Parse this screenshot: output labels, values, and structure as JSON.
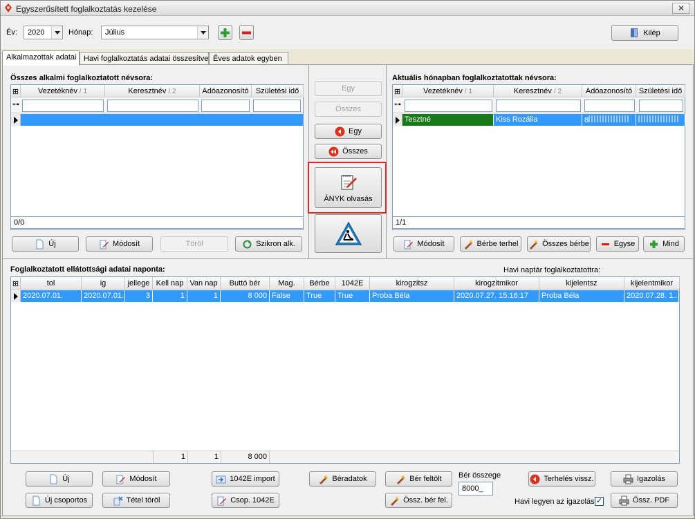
{
  "window": {
    "title": "Egyszerűsített foglalkoztatás kezelése",
    "close_glyph": "✕"
  },
  "top": {
    "year_label": "Év:",
    "year_value": "2020",
    "month_label": "Hónap:",
    "month_value": "Július",
    "exit_label": "Kilép"
  },
  "tabs": [
    {
      "label": "Alkalmazottak adatai"
    },
    {
      "label": "Havi foglalkoztatás adatai összesítve"
    },
    {
      "label": "Éves adatok egyben"
    }
  ],
  "left_grid": {
    "title": "Összes alkalmi foglalkoztatott névsora:",
    "columns": [
      "Vezetéknév",
      "Keresztnév",
      "Adóazonosító",
      "Születési idő"
    ],
    "sort_marks": [
      "/ 1",
      "/ 2"
    ],
    "status": "0/0",
    "buttons": {
      "new": "Új",
      "edit": "Módosít",
      "delete": "Töröl",
      "sync": "Szikron alk."
    }
  },
  "middle": {
    "one_right": "Egy",
    "all_right": "Összes",
    "one_left": "Egy",
    "all_left": "Összes",
    "anyk": "ÁNYK olvasás"
  },
  "right_grid": {
    "title": "Aktuális hónapban foglalkoztatottak névsora:",
    "columns": [
      "Vezetéknév",
      "Keresztnév",
      "Adóazonosító",
      "Születési idő"
    ],
    "sort_marks": [
      "/ 1",
      "/ 2"
    ],
    "rows": [
      {
        "last": "Tesztné",
        "first": "Kiss Rozália",
        "tax": "8",
        "birth": ""
      }
    ],
    "status": "1/1",
    "buttons": {
      "edit": "Módosít",
      "charge": "Bérbe terhel",
      "all_charge": "Összes bérbe",
      "one": "Egyse",
      "all": "Mind"
    }
  },
  "bottom_grid": {
    "title": "Foglalkoztatott ellátottsági adatai naponta:",
    "calendar_label": "Havi naptár foglalkoztatottra:",
    "columns": [
      "tol",
      "ig",
      "jellege",
      "Kell nap",
      "Van nap",
      "Buttó bér",
      "Mag.",
      "Bérbe",
      "1042E",
      "kirogzitsz",
      "kirogzitmikor",
      "kijelentsz",
      "kijelentmikor"
    ],
    "rows": [
      {
        "tol": "2020.07.01.",
        "ig": "2020.07.01.",
        "jellege": "3",
        "kell": "1",
        "van": "1",
        "ber": "8 000",
        "mag": "False",
        "berbe": "True",
        "e1042": "True",
        "kirogzitsz": "Proba Béla",
        "kirogzitmikor": "2020.07.27. 15:16:17",
        "kijelentsz": "Proba Béla",
        "kijelentmikor": "2020.07.28. 1..."
      }
    ],
    "totals": {
      "kell": "1",
      "van": "1",
      "ber": "8 000"
    }
  },
  "bottom_buttons": {
    "new": "Új",
    "edit": "Módosít",
    "import_1042e": "1042E import",
    "wage_data": "Béradatok",
    "wage_upload": "Bér feltölt",
    "charge_back": "Terhelés vissz.",
    "certificate": "Igazolás",
    "new_group": "Új csoportos",
    "delete_item": "Tétel töröl",
    "group_1042e": "Csop. 1042E",
    "sum_wage_up": "Össz. bér fel.",
    "sum_pdf": "Össz. PDF"
  },
  "wage_sum": {
    "label": "Bér összege",
    "value": "8000_"
  },
  "monthly_cert": {
    "label": "Havi legyen az igazolás",
    "checked": true,
    "check_glyph": "✓"
  }
}
